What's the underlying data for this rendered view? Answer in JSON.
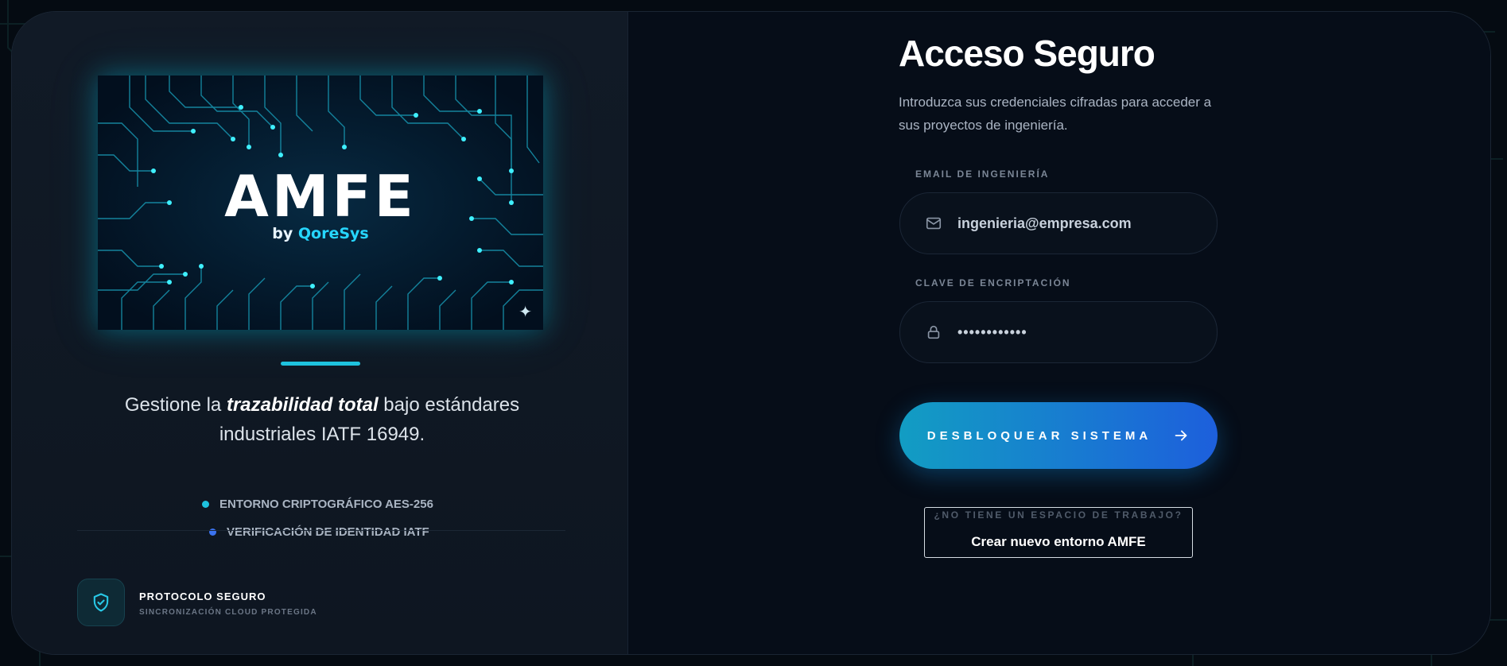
{
  "hero": {
    "logo": "AMFE",
    "by": "by",
    "brand": "QoreSys"
  },
  "left": {
    "tagline": {
      "before": "Gestione la ",
      "emphasis": "trazabilidad total",
      "after": " bajo estándares industriales IATF 16949."
    },
    "features": [
      {
        "label": "ENTORNO CRIPTOGRÁFICO AES-256",
        "dot_color": "#1ec2de"
      },
      {
        "label": "VERIFICACIÓN DE IDENTIDAD IATF",
        "dot_color": "#3b73f0"
      }
    ],
    "protocol": {
      "title": "PROTOCOLO SEGURO",
      "subtitle": "SINCRONIZACIÓN CLOUD PROTEGIDA",
      "icon": "shield-check-icon"
    }
  },
  "login": {
    "title": "Acceso Seguro",
    "subtitle": "Introduzca sus credenciales cifradas para acceder a sus proyectos de ingeniería.",
    "email": {
      "label": "EMAIL DE INGENIERÍA",
      "value": "ingenieria@empresa.com",
      "icon": "mail-icon"
    },
    "password": {
      "label": "CLAVE DE ENCRIPTACIÓN",
      "value": "••••••••••••",
      "icon": "lock-icon"
    },
    "submit_label": "DESBLOQUEAR SISTEMA",
    "workspace_question": "¿NO TIENE UN ESPACIO DE TRABAJO?",
    "workspace_link": "Crear nuevo entorno AMFE"
  },
  "colors": {
    "accent_cyan": "#1ec2de",
    "accent_blue": "#1d5fdc",
    "background": "#050b12"
  }
}
